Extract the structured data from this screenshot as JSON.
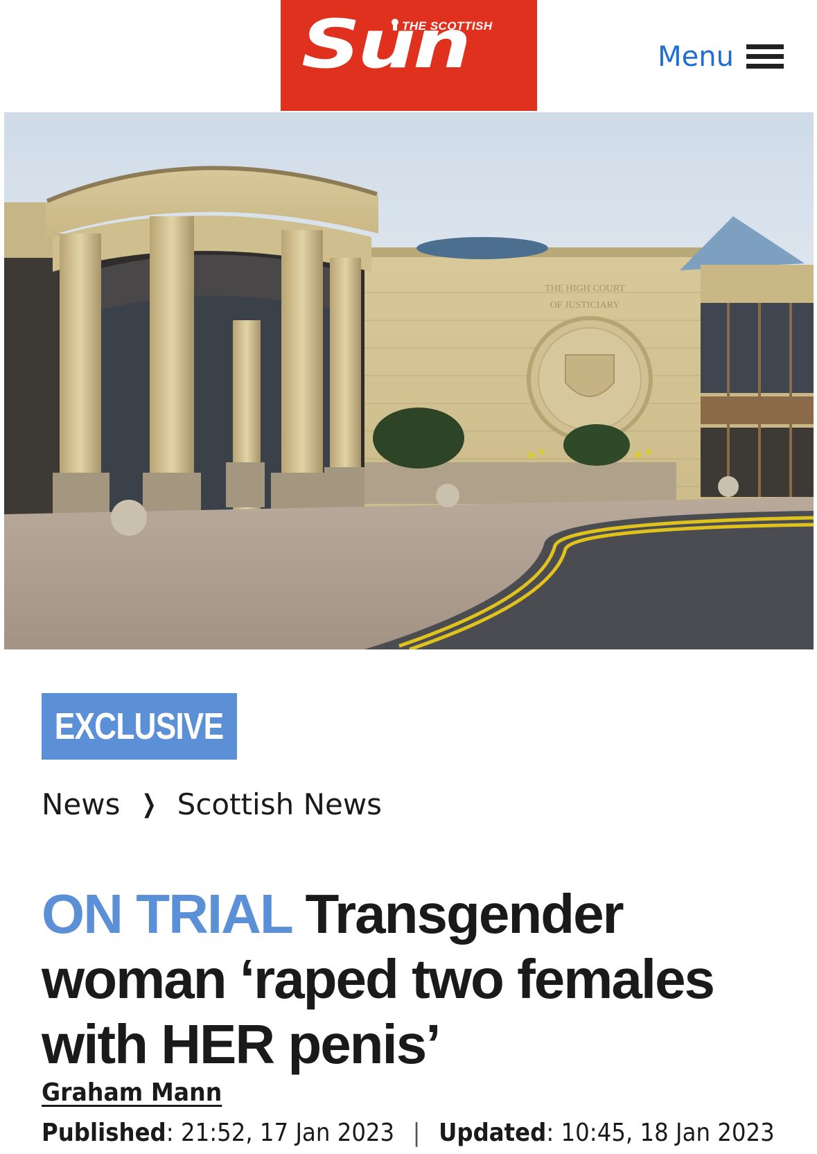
{
  "header": {
    "logo_small": "THE SCOTTISH",
    "logo_main": "Sun",
    "menu_label": "Menu"
  },
  "colors": {
    "brand_red": "#e0301e",
    "accent_blue": "#5b8fd6",
    "menu_blue": "#1f6ed4"
  },
  "hero": {
    "sign_line1": "THE HIGH COURT",
    "sign_line2": "OF JUSTICIARY"
  },
  "tag": {
    "label": "EXCLUSIVE"
  },
  "breadcrumb": {
    "items": [
      "News",
      "Scottish News"
    ],
    "separator_icon": "chevron-right-icon"
  },
  "headline": {
    "kicker": "ON TRIAL",
    "text": "Transgender woman ‘raped two females with HER penis’"
  },
  "byline": {
    "author": "Graham Mann",
    "published_label": "Published",
    "published_value": "21:52, 17 Jan 2023",
    "updated_label": "Updated",
    "updated_value": "10:45, 18 Jan 2023"
  }
}
